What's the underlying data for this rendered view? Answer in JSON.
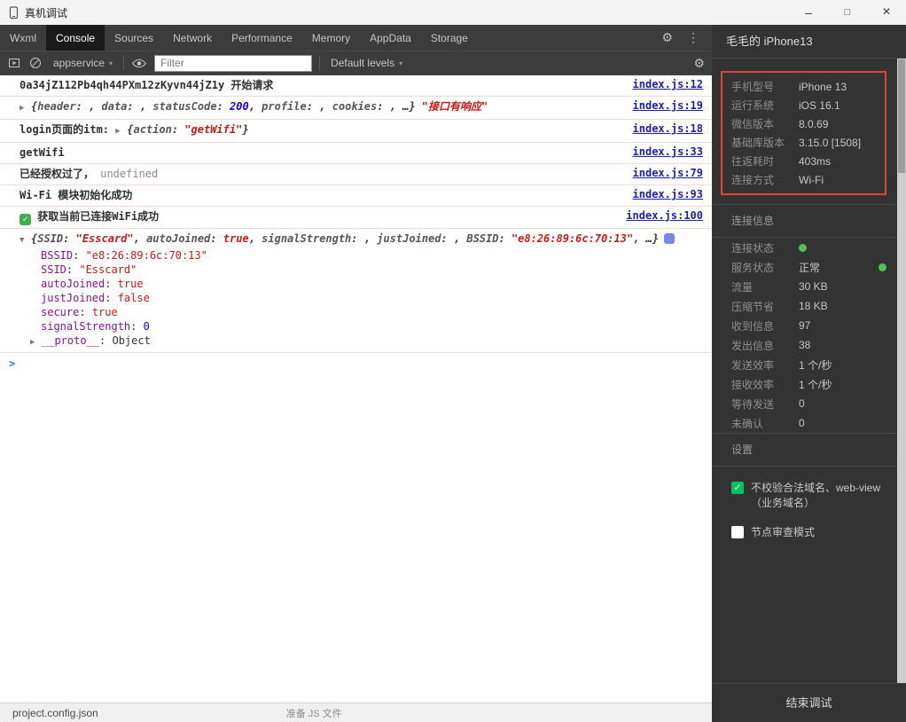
{
  "window": {
    "title": "真机调试",
    "controls": {
      "minimize": "–",
      "maximize": "□",
      "close": "×"
    }
  },
  "icons": {
    "gear": "⚙",
    "kebab": "⋮",
    "caret_down": "▼",
    "caret_right": "▶",
    "dropdown_caret": "▾",
    "check": "✓",
    "prompt": ">"
  },
  "colors": {
    "annotation_red": "#e0443c",
    "wechat_green": "#07c160",
    "status_green": "#4fc454",
    "link_blue": "#1e1ea8"
  },
  "tabs": {
    "items": [
      {
        "label": "Wxml",
        "active": false
      },
      {
        "label": "Console",
        "active": true
      },
      {
        "label": "Sources",
        "active": false
      },
      {
        "label": "Network",
        "active": false
      },
      {
        "label": "Performance",
        "active": false
      },
      {
        "label": "Memory",
        "active": false
      },
      {
        "label": "AppData",
        "active": false
      },
      {
        "label": "Storage",
        "active": false
      }
    ]
  },
  "toolbar": {
    "context": "appservice",
    "filter_placeholder": "Filter",
    "levels": "Default levels"
  },
  "console": {
    "prompt": ">",
    "messages": [
      {
        "parts": [
          {
            "k": "text",
            "v": "0a34jZ112Pb4qh44PXm12zKyvn44jZ1y 开始请求"
          }
        ],
        "link": "index.js:12"
      },
      {
        "parts": [
          {
            "k": "caret-right"
          },
          {
            "k": "obj",
            "v": "{"
          },
          {
            "k": "key",
            "v": "header"
          },
          {
            "k": "obj",
            "v": ": , "
          },
          {
            "k": "key",
            "v": "data"
          },
          {
            "k": "obj",
            "v": ": , "
          },
          {
            "k": "key",
            "v": "statusCode"
          },
          {
            "k": "obj",
            "v": ": "
          },
          {
            "k": "num",
            "v": "200"
          },
          {
            "k": "obj",
            "v": ", "
          },
          {
            "k": "key",
            "v": "profile"
          },
          {
            "k": "obj",
            "v": ": , "
          },
          {
            "k": "key",
            "v": "cookies"
          },
          {
            "k": "obj",
            "v": ": , …}"
          },
          {
            "k": "str",
            "v": " \"接口有响应\""
          }
        ],
        "link": "index.js:19"
      },
      {
        "parts": [
          {
            "k": "text",
            "v": "login页面的itm: "
          },
          {
            "k": "caret-right"
          },
          {
            "k": "obj",
            "v": "{"
          },
          {
            "k": "key",
            "v": "action"
          },
          {
            "k": "obj",
            "v": ": "
          },
          {
            "k": "str",
            "v": "\"getWifi\""
          },
          {
            "k": "obj",
            "v": "}"
          }
        ],
        "link": "index.js:18"
      },
      {
        "parts": [
          {
            "k": "text",
            "v": "getWifi"
          }
        ],
        "link": "index.js:33"
      },
      {
        "parts": [
          {
            "k": "text",
            "v": "已经授权过了， "
          },
          {
            "k": "undef",
            "v": "undefined"
          }
        ],
        "link": "index.js:79"
      },
      {
        "parts": [
          {
            "k": "text",
            "v": "Wi-Fi 模块初始化成功"
          }
        ],
        "link": "index.js:93"
      },
      {
        "parts": [
          {
            "k": "check"
          },
          {
            "k": "text",
            "v": " 获取当前已连接WiFi成功"
          }
        ],
        "link": "index.js:100"
      },
      {
        "parts": [
          {
            "k": "caret-down"
          },
          {
            "k": "obj",
            "v": "{"
          },
          {
            "k": "key",
            "v": "SSID"
          },
          {
            "k": "obj",
            "v": ": "
          },
          {
            "k": "str",
            "v": "\"Esscard\""
          },
          {
            "k": "obj",
            "v": ", "
          },
          {
            "k": "key",
            "v": "autoJoined"
          },
          {
            "k": "obj",
            "v": ": "
          },
          {
            "k": "bool",
            "v": "true"
          },
          {
            "k": "obj",
            "v": ", "
          },
          {
            "k": "key",
            "v": "signalStrength"
          },
          {
            "k": "obj",
            "v": ": , "
          },
          {
            "k": "key",
            "v": "justJoined"
          },
          {
            "k": "obj",
            "v": ": , "
          },
          {
            "k": "key",
            "v": "BSSID"
          },
          {
            "k": "obj",
            "v": ": "
          },
          {
            "k": "str",
            "v": "\"e8:26:89:6c:70:13\""
          },
          {
            "k": "obj",
            "v": ", …}"
          },
          {
            "k": "badge"
          }
        ],
        "children": [
          {
            "pad": 24,
            "parts": [
              {
                "k": "tkey",
                "v": "BSSID"
              },
              {
                "k": "ttext",
                "v": ": "
              },
              {
                "k": "tstr",
                "v": "\"e8:26:89:6c:70:13\""
              }
            ]
          },
          {
            "pad": 24,
            "parts": [
              {
                "k": "tkey",
                "v": "SSID"
              },
              {
                "k": "ttext",
                "v": ": "
              },
              {
                "k": "tstr",
                "v": "\"Esscard\""
              }
            ]
          },
          {
            "pad": 24,
            "parts": [
              {
                "k": "tkey",
                "v": "autoJoined"
              },
              {
                "k": "ttext",
                "v": ": "
              },
              {
                "k": "tbool",
                "v": "true"
              }
            ]
          },
          {
            "pad": 24,
            "parts": [
              {
                "k": "tkey",
                "v": "justJoined"
              },
              {
                "k": "ttext",
                "v": ": "
              },
              {
                "k": "tbool",
                "v": "false"
              }
            ]
          },
          {
            "pad": 24,
            "parts": [
              {
                "k": "tkey",
                "v": "secure"
              },
              {
                "k": "ttext",
                "v": ": "
              },
              {
                "k": "tbool",
                "v": "true"
              }
            ]
          },
          {
            "pad": 24,
            "parts": [
              {
                "k": "tkey",
                "v": "signalStrength"
              },
              {
                "k": "ttext",
                "v": ": "
              },
              {
                "k": "tnum",
                "v": "0"
              }
            ]
          },
          {
            "pad": 12,
            "parts": [
              {
                "k": "caret-right"
              },
              {
                "k": "tkey",
                "v": "__proto__"
              },
              {
                "k": "ttext",
                "v": ": "
              },
              {
                "k": "tobj",
                "v": "Object"
              }
            ]
          }
        ],
        "link": null
      }
    ]
  },
  "panel": {
    "header": "毛毛的 iPhone13",
    "device_info": [
      {
        "label": "手机型号",
        "value": "iPhone 13"
      },
      {
        "label": "运行系统",
        "value": "iOS 16.1"
      },
      {
        "label": "微信版本",
        "value": "8.0.69"
      },
      {
        "label": "基础库版本",
        "value": "3.15.0 [1508]"
      },
      {
        "label": "往返耗时",
        "value": "403ms"
      },
      {
        "label": "连接方式",
        "value": "Wi-Fi"
      }
    ],
    "connection": {
      "title": "连接信息",
      "rows": [
        {
          "label": "连接状态",
          "value": "",
          "dot": true
        },
        {
          "label": "服务状态",
          "value": "正常",
          "trailing_dot": true
        },
        {
          "label": "流量",
          "value": "30 KB"
        },
        {
          "label": "压缩节省",
          "value": "18 KB"
        },
        {
          "label": "收到信息",
          "value": "97"
        },
        {
          "label": "发出信息",
          "value": "38"
        },
        {
          "label": "发送效率",
          "value": "1 个/秒"
        },
        {
          "label": "接收效率",
          "value": "1 个/秒"
        },
        {
          "label": "等待发送",
          "value": "0"
        },
        {
          "label": "未确认",
          "value": "0"
        }
      ]
    },
    "settings": {
      "title": "设置",
      "options": [
        {
          "label": "不校验合法域名、web-view（业务域名）",
          "checked": true
        },
        {
          "label": "节点审查模式",
          "checked": false
        }
      ]
    },
    "end_button": "结束调试"
  },
  "background_statusbar": {
    "file": "project.config.json",
    "status": "准备 JS 文件"
  }
}
